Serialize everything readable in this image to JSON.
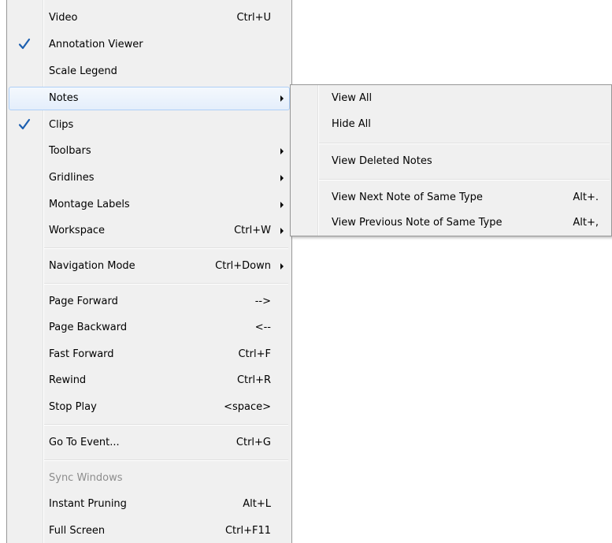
{
  "main_menu": {
    "items": [
      {
        "label": "Video",
        "shortcut": "Ctrl+U"
      },
      {
        "label": "Annotation Viewer",
        "shortcut": ""
      },
      {
        "label": "Scale Legend",
        "shortcut": ""
      },
      {
        "label": "Notes",
        "shortcut": ""
      },
      {
        "label": "Clips",
        "shortcut": ""
      },
      {
        "label": "Toolbars",
        "shortcut": ""
      },
      {
        "label": "Gridlines",
        "shortcut": ""
      },
      {
        "label": "Montage Labels",
        "shortcut": ""
      },
      {
        "label": "Workspace",
        "shortcut": "Ctrl+W"
      },
      {
        "label": "Navigation Mode",
        "shortcut": "Ctrl+Down"
      },
      {
        "label": "Page Forward",
        "shortcut": "-->"
      },
      {
        "label": "Page Backward",
        "shortcut": "<--"
      },
      {
        "label": "Fast Forward",
        "shortcut": "Ctrl+F"
      },
      {
        "label": "Rewind",
        "shortcut": "Ctrl+R"
      },
      {
        "label": "Stop Play",
        "shortcut": "<space>"
      },
      {
        "label": "Go To Event...",
        "shortcut": "Ctrl+G"
      },
      {
        "label": "Sync Windows",
        "shortcut": ""
      },
      {
        "label": "Instant Pruning",
        "shortcut": "Alt+L"
      },
      {
        "label": "Full Screen",
        "shortcut": "Ctrl+F11"
      }
    ]
  },
  "submenu_notes": {
    "items": [
      {
        "label": "View All",
        "shortcut": ""
      },
      {
        "label": "Hide All",
        "shortcut": ""
      },
      {
        "label": "View Deleted Notes",
        "shortcut": ""
      },
      {
        "label": "View Next Note of Same Type",
        "shortcut": "Alt+."
      },
      {
        "label": "View Previous Note of Same Type",
        "shortcut": "Alt+,"
      }
    ]
  },
  "icons": {
    "checkmark": "checkmark-icon",
    "submenu_arrow": "submenu-arrow-icon"
  },
  "colors": {
    "menu_background": "#f0f0f0",
    "highlight_border": "#aecff7",
    "checkmark": "#1c5fb0",
    "disabled_text": "#8d8d8d"
  }
}
